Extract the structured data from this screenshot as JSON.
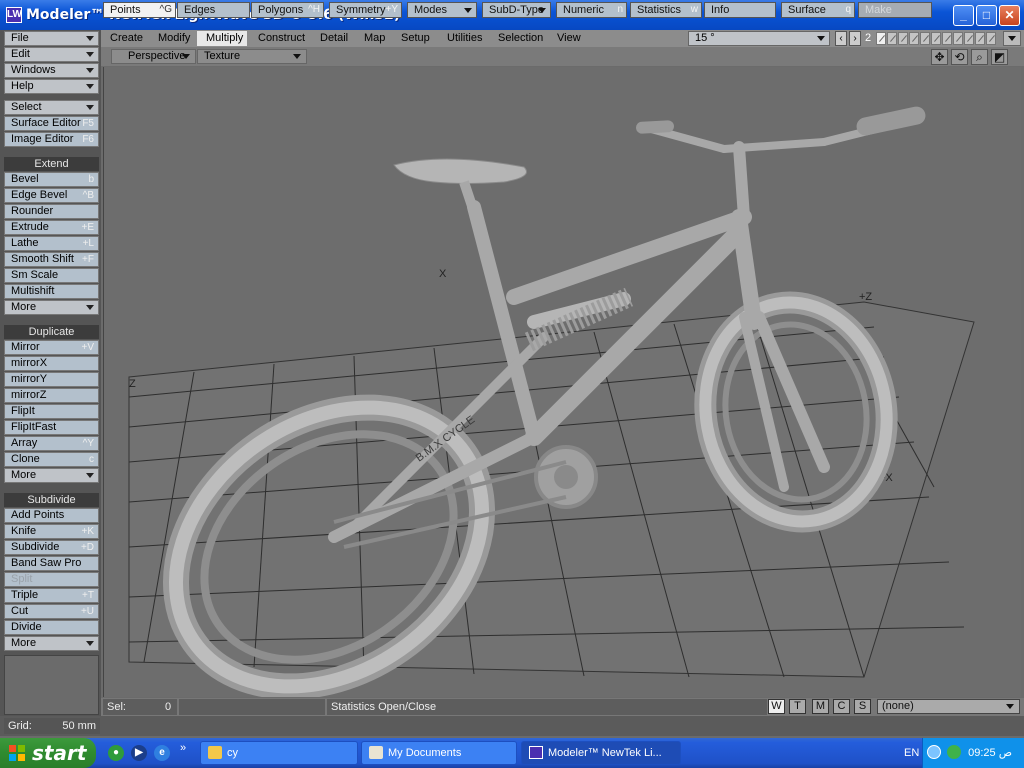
{
  "window": {
    "title": "Modeler™ NewTek LightWave 3D ® 9.6  (Win32)",
    "icon": "lightwave-icon",
    "buttons": [
      "minimize",
      "maximize",
      "close"
    ]
  },
  "left_toolbar": {
    "top_menus": [
      {
        "label": "File"
      },
      {
        "label": "Edit"
      },
      {
        "label": "Windows"
      },
      {
        "label": "Help"
      }
    ],
    "select": {
      "label": "Select"
    },
    "editors": [
      {
        "label": "Surface Editor",
        "shortcut": "F5"
      },
      {
        "label": "Image Editor",
        "shortcut": "F6"
      }
    ],
    "extend": {
      "header": "Extend",
      "items": [
        {
          "label": "Bevel",
          "shortcut": "b"
        },
        {
          "label": "Edge Bevel",
          "shortcut": "^B"
        },
        {
          "label": "Rounder",
          "shortcut": ""
        },
        {
          "label": "Extrude",
          "shortcut": "+E"
        },
        {
          "label": "Lathe",
          "shortcut": "+L"
        },
        {
          "label": "Smooth Shift",
          "shortcut": "+F"
        },
        {
          "label": "Sm Scale",
          "shortcut": ""
        },
        {
          "label": "Multishift",
          "shortcut": ""
        }
      ],
      "more": "More"
    },
    "duplicate": {
      "header": "Duplicate",
      "items": [
        {
          "label": "Mirror",
          "shortcut": "+V"
        },
        {
          "label": "mirrorX",
          "shortcut": ""
        },
        {
          "label": "mirrorY",
          "shortcut": ""
        },
        {
          "label": "mirrorZ",
          "shortcut": ""
        },
        {
          "label": "FlipIt",
          "shortcut": ""
        },
        {
          "label": "FlipItFast",
          "shortcut": ""
        },
        {
          "label": "Array",
          "shortcut": "^Y"
        },
        {
          "label": "Clone",
          "shortcut": "c"
        }
      ],
      "more": "More"
    },
    "subdivide": {
      "header": "Subdivide",
      "items": [
        {
          "label": "Add Points",
          "shortcut": ""
        },
        {
          "label": "Knife",
          "shortcut": "+K"
        },
        {
          "label": "Subdivide",
          "shortcut": "+D"
        },
        {
          "label": "Band Saw Pro",
          "shortcut": ""
        },
        {
          "label": "Split",
          "shortcut": "",
          "disabled": true
        },
        {
          "label": "Triple",
          "shortcut": "+T"
        },
        {
          "label": "Cut",
          "shortcut": "+U"
        },
        {
          "label": "Divide",
          "shortcut": ""
        }
      ],
      "more": "More"
    }
  },
  "tabs": [
    {
      "label": "Create"
    },
    {
      "label": "Modify"
    },
    {
      "label": "Multiply",
      "active": true
    },
    {
      "label": "Construct"
    },
    {
      "label": "Detail"
    },
    {
      "label": "Map"
    },
    {
      "label": "Setup"
    },
    {
      "label": "Utilities"
    },
    {
      "label": "Selection"
    },
    {
      "label": "View"
    }
  ],
  "view_angle": "15 °",
  "layer": {
    "number": "2"
  },
  "viewport": {
    "view_type": "Perspective",
    "render_mode": "Texture",
    "tools": [
      "move-view-icon",
      "rotate-view-icon",
      "zoom-view-icon",
      "maximize-viewport-icon"
    ],
    "axis_labels": {
      "x": "X",
      "z": "Z",
      "z_pos": "+Z",
      "x_pos": "+X"
    },
    "model_text": "B.M.X CYCLE"
  },
  "status": {
    "sel_label": "Sel:",
    "sel_value": "0",
    "info": "Statistics Open/Close",
    "wtmcs": [
      "W",
      "T",
      "M",
      "C",
      "S"
    ],
    "surface": "(none)"
  },
  "bottom_bar": {
    "grid_label": "Grid:",
    "grid_value": "50 mm",
    "buttons": [
      {
        "label": "Points",
        "shortcut": "^G"
      },
      {
        "label": "Edges",
        "shortcut": ""
      },
      {
        "label": "Polygons",
        "shortcut": "^H"
      },
      {
        "label": "Symmetry",
        "shortcut": "+Y"
      },
      {
        "label": "Modes",
        "shortcut": ""
      },
      {
        "label": "SubD-Type",
        "shortcut": ""
      },
      {
        "label": "Numeric",
        "shortcut": "n"
      },
      {
        "label": "Statistics",
        "shortcut": "w"
      },
      {
        "label": "Info",
        "shortcut": ""
      },
      {
        "label": "Surface",
        "shortcut": "q"
      },
      {
        "label": "Make",
        "shortcut": ""
      }
    ]
  },
  "taskbar": {
    "start": "start",
    "tasks": [
      {
        "label": "cy"
      },
      {
        "label": "My Documents"
      },
      {
        "label": "Modeler™ NewTek Li..."
      }
    ],
    "lang": "EN",
    "clock": "09:25 ص"
  }
}
